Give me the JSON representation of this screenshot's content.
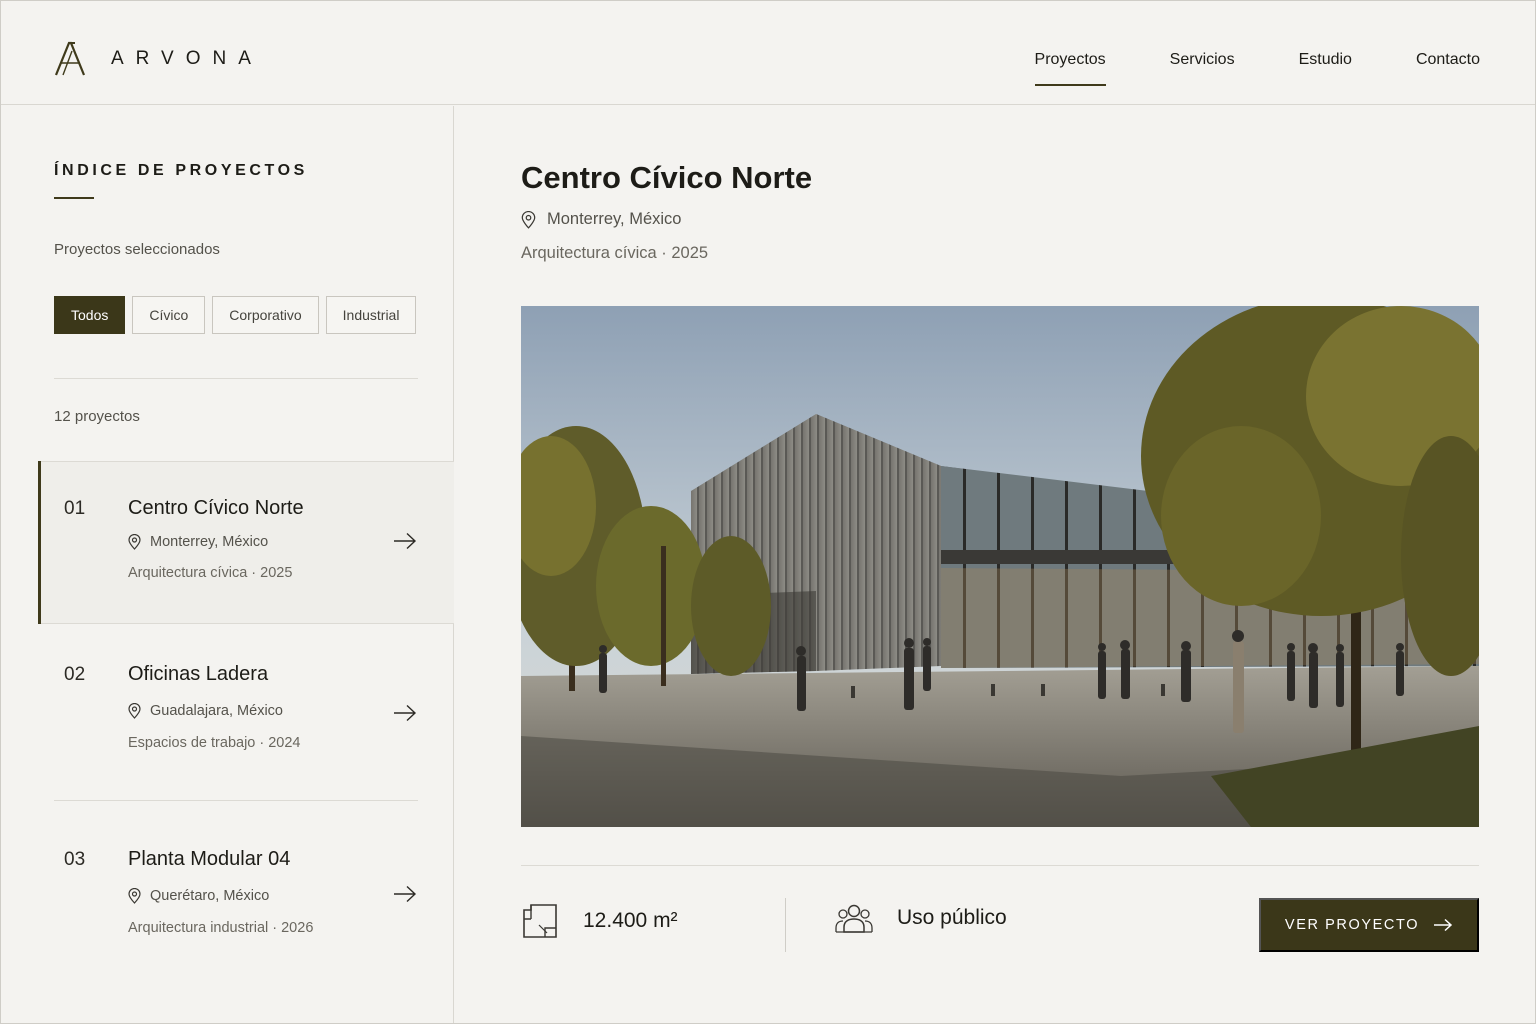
{
  "brand": {
    "name": "ARVONA"
  },
  "nav": [
    {
      "label": "Proyectos",
      "active": true
    },
    {
      "label": "Servicios",
      "active": false
    },
    {
      "label": "Estudio",
      "active": false
    },
    {
      "label": "Contacto",
      "active": false
    }
  ],
  "sidebar": {
    "title": "ÍNDICE DE PROYECTOS",
    "subtitle": "Proyectos seleccionados",
    "filters": [
      {
        "label": "Todos",
        "active": true
      },
      {
        "label": "Cívico",
        "active": false
      },
      {
        "label": "Corporativo",
        "active": false
      },
      {
        "label": "Industrial",
        "active": false
      }
    ],
    "count": "12 proyectos",
    "projects": [
      {
        "num": "01",
        "name": "Centro Cívico Norte",
        "location": "Monterrey, México",
        "meta": "Arquitectura cívica  ·  2025",
        "active": true
      },
      {
        "num": "02",
        "name": "Oficinas Ladera",
        "location": "Guadalajara, México",
        "meta": "Espacios de trabajo  ·  2024",
        "active": false
      },
      {
        "num": "03",
        "name": "Planta Modular 04",
        "location": "Querétaro, México",
        "meta": "Arquitectura industrial  ·  2026",
        "active": false
      }
    ]
  },
  "detail": {
    "title": "Centro Cívico Norte",
    "location": "Monterrey, México",
    "meta": "Arquitectura cívica   ·   2025",
    "area": "12.400 m²",
    "use": "Uso público",
    "cta": "VER PROYECTO"
  },
  "colors": {
    "accent": "#3b3719",
    "background": "#f4f3f0"
  },
  "icons": {
    "location": "map-pin-icon",
    "arrow": "arrow-right-icon",
    "area": "floor-plan-icon",
    "users": "users-icon"
  }
}
